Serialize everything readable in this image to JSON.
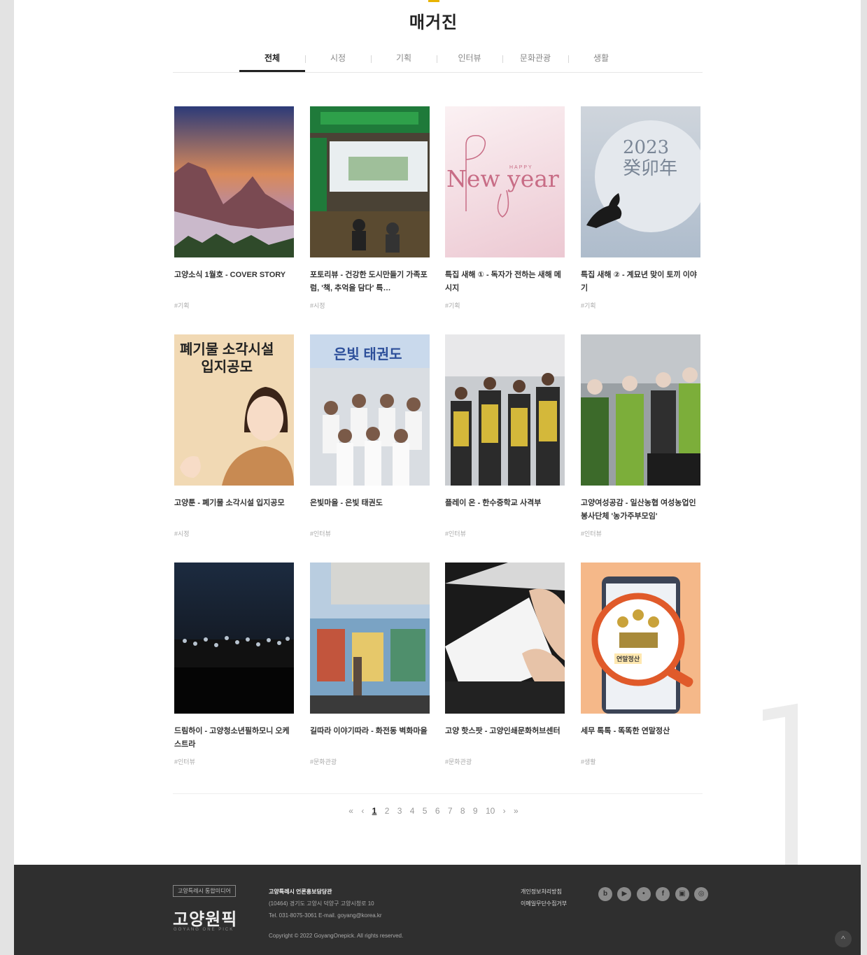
{
  "page": {
    "title": "매거진"
  },
  "tabs": [
    "전체",
    "시정",
    "기획",
    "인터뷰",
    "문화관광",
    "생활"
  ],
  "active_tab": "전체",
  "cards": [
    {
      "title": "고양소식 1월호 - COVER STORY",
      "tag": "#기획"
    },
    {
      "title": "포토리뷰 - 건강한 도시만들기 가족포럼, '책, 추억을 담다' 특…",
      "tag": "#시정"
    },
    {
      "title": "특집 새해 ① - 독자가 전하는 새해 메시지",
      "tag": "#기획"
    },
    {
      "title": "특집 새해 ② - 계묘년 맞이 토끼 이야기",
      "tag": "#기획"
    },
    {
      "title": "고양툰 - 폐기물 소각시설 입지공모",
      "tag": "#시정"
    },
    {
      "title": "은빛마을 - 은빛 태권도",
      "tag": "#인터뷰"
    },
    {
      "title": "플레이 온 - 한수중학교 사격부",
      "tag": "#인터뷰"
    },
    {
      "title": "고양여성공감 - 일산농협 여성농업인봉사단체 '농가주부모임'",
      "tag": "#인터뷰"
    },
    {
      "title": "드림하이 - 고양청소년필하모니 오케스트라",
      "tag": "#인터뷰"
    },
    {
      "title": "길따라 이야기따라 - 화전동 벽화마을",
      "tag": "#문화관광"
    },
    {
      "title": "고양 핫스팟 - 고양인쇄문화허브센터",
      "tag": "#문화관광"
    },
    {
      "title": "세무 톡톡 - 똑똑한 연말정산",
      "tag": "#생활"
    }
  ],
  "thumb_texts": {
    "happy": "HAPPY",
    "new_year": "New year",
    "rabbit_year": "2023\n癸卯年",
    "waste_poster": "폐기물 소각시설\n입지공모",
    "taekwondo_banner": "은빛 태권도",
    "tax_tag": "연말정산"
  },
  "pagination": {
    "first": "«",
    "prev": "‹",
    "pages": [
      "1",
      "2",
      "3",
      "4",
      "5",
      "6",
      "7",
      "8",
      "9",
      "10"
    ],
    "current": "1",
    "next": "›",
    "last": "»"
  },
  "footer": {
    "badge": "고양특례시 통합미디어",
    "logo": "고양원픽",
    "logo_sub": "GOYANG ONE PICK",
    "org": "고양특례시 언론홍보담당관",
    "address": "(10464) 경기도 고양시 덕양구 고양시청로 10",
    "contact": "Tel. 031-8075-3061    E-mail. goyang@korea.kr",
    "copyright": "Copyright © 2022 GoyangOnepick. All rights reserved.",
    "links": [
      "개인정보처리방침",
      "이메일무단수집거부"
    ],
    "social": [
      "blog",
      "youtube",
      "talk",
      "facebook",
      "instagram-tv",
      "instagram"
    ]
  },
  "colors": {
    "accent": "#e8b300",
    "footer_bg": "#2f2f2f",
    "background": "#e3e3e3"
  },
  "icons": {
    "to_top": "chevron-up-icon"
  }
}
